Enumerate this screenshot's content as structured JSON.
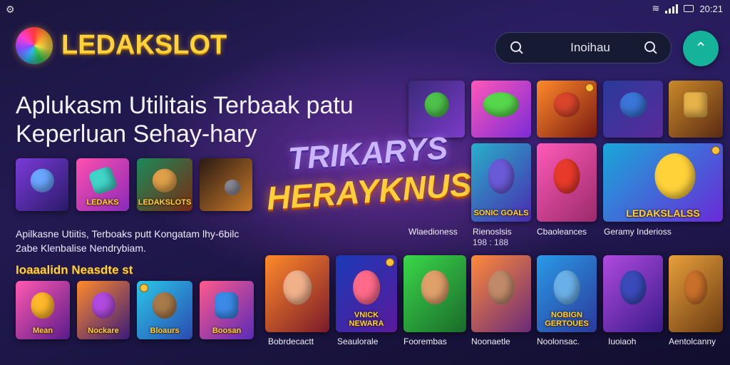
{
  "status_bar": {
    "time": "20:21"
  },
  "header": {
    "logo_text": "LEDAKSLOT",
    "search_query": "Inoihau",
    "icons": {
      "left": "search-icon",
      "right": "search-icon",
      "action": "hanger-icon"
    }
  },
  "hero": {
    "headline_line1": "Aplukasm Utilitais Terbaak patu",
    "headline_line2": "Keperluan Sehay-hary",
    "banner_line1": "TRIKARYS",
    "banner_line2": "HERAYKNUSA!",
    "paragraph_line1": "Apilkasne Utiitis, Terboaks putt Kongatam lhy-6bilc",
    "paragraph_line2": "2abe Klenbalise Nendrybiam."
  },
  "row1_left_tiles": [
    {
      "label": ""
    },
    {
      "label": "LEDAKS"
    },
    {
      "label": "LEDAKSLOTS"
    },
    {
      "label": ""
    }
  ],
  "right_grid_top": [
    {
      "label": ""
    },
    {
      "label": ""
    },
    {
      "label": ""
    },
    {
      "label": ""
    },
    {
      "label": ""
    }
  ],
  "right_grid_mid": [
    {
      "label": "SONIC GOALS",
      "caption": "Wlaedioness"
    },
    {
      "label": "",
      "caption": "Rienoslsis",
      "subcaption": "198 : 188"
    },
    {
      "label": "LEDAKSLALSS",
      "caption": "Cbaoleances"
    },
    {
      "label": "",
      "caption": "Geramy Inderioss"
    }
  ],
  "section_title": "Ioaaalidn Neasdte st",
  "row2_left_tiles": [
    {
      "label": "Mean"
    },
    {
      "label": "Nockare"
    },
    {
      "label": "Bloaurs"
    },
    {
      "label": "Boosan"
    }
  ],
  "bottom_tiles": [
    {
      "label": "",
      "caption": "Bobrdecactt"
    },
    {
      "label": "VNICK NEWARA",
      "caption": "Seaulorale"
    },
    {
      "label": "",
      "caption": "Foorembas"
    },
    {
      "label": "",
      "caption": "Noonaetle"
    },
    {
      "label": "NOBIGN GERTOUES",
      "caption": "Noolonsac."
    },
    {
      "label": "",
      "caption": "Iuoiaoh"
    },
    {
      "label": "",
      "caption": "Aentolcanny"
    }
  ]
}
